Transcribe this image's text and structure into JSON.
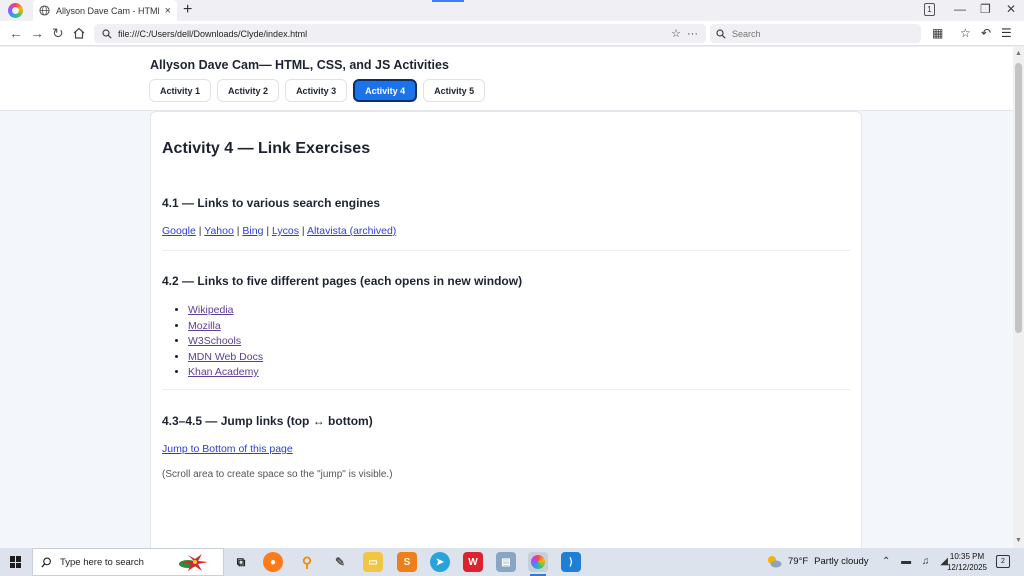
{
  "browser": {
    "tab_title": "Allyson Dave Cam - HTML, C",
    "tab_close": "×",
    "new_tab": "+",
    "tab_count": "1",
    "win_min": "—",
    "win_restore": "❐",
    "win_close": "✕",
    "url": "file:///C:/Users/dell/Downloads/Clyde/index.html",
    "search_placeholder": "Search"
  },
  "site": {
    "title": "Allyson Dave Cam— HTML, CSS, and JS Activities",
    "nav": [
      "Activity 1",
      "Activity 2",
      "Activity 3",
      "Activity 4",
      "Activity 5"
    ],
    "active_index": 3
  },
  "page": {
    "heading": "Activity 4 — Link Exercises",
    "s1": {
      "heading": "4.1 — Links to various search engines",
      "links": [
        "Google",
        "Yahoo",
        "Bing",
        "Lycos",
        "Altavista (archived)"
      ],
      "separator": " | "
    },
    "s2": {
      "heading": "4.2 — Links to five different pages (each opens in new window)",
      "links": [
        "Wikipedia",
        "Mozilla",
        "W3Schools",
        "MDN Web Docs",
        "Khan Academy"
      ]
    },
    "s3": {
      "heading": "4.3–4.5 — Jump links (top ↔ bottom)",
      "jump_link": "Jump to Bottom of this page",
      "note": "(Scroll area to create space so the \"jump\" is visible.)"
    }
  },
  "taskbar": {
    "search_text": "Type here to search",
    "weather_temp": "79°F",
    "weather_desc": "Partly cloudy",
    "time": "10:35 PM",
    "date": "12/12/2025",
    "notification_count": "2"
  },
  "colors": {
    "accent": "#1a73e8",
    "link": "#2b3fd8",
    "visited_link": "#5b3d9a"
  }
}
